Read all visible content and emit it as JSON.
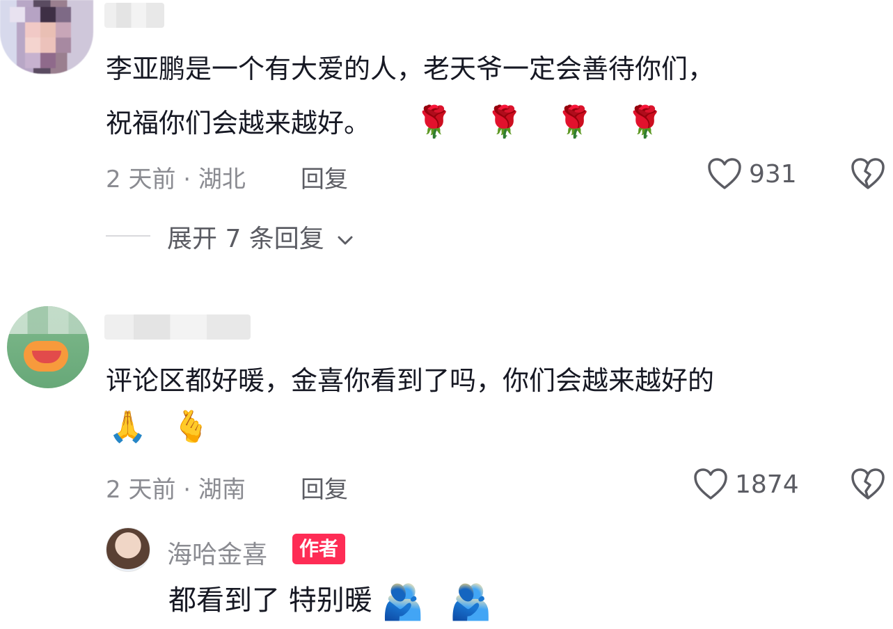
{
  "comments": [
    {
      "text_line1": "李亚鹏是一个有大爱的人，老天爷一定会善待你们，",
      "text_line2": "祝福你们会越来越好。",
      "emojis": [
        "🌹",
        "🌹",
        "🌹",
        "🌹"
      ],
      "meta": "2 天前 · 湖北",
      "reply_label": "回复",
      "likes": "931",
      "expand_label": "展开 7 条回复"
    },
    {
      "text_line1": "评论区都好暖，金喜你看到了吗，你们会越来越好的",
      "emojis": [
        "🙏",
        "🫰"
      ],
      "meta": "2 天前 · 湖南",
      "reply_label": "回复",
      "likes": "1874"
    }
  ],
  "author_reply": {
    "name": "海哈金喜",
    "badge": "作者",
    "text": "都看到了 特别暖",
    "emojis": [
      "🫂",
      "🫂"
    ]
  },
  "icons": {
    "like": "heart-outline-icon",
    "dislike": "broken-heart-icon",
    "expand": "chevron-down-icon"
  },
  "colors": {
    "text": "#161823",
    "meta": "#8a8b91",
    "badge": "#fe2c55"
  }
}
